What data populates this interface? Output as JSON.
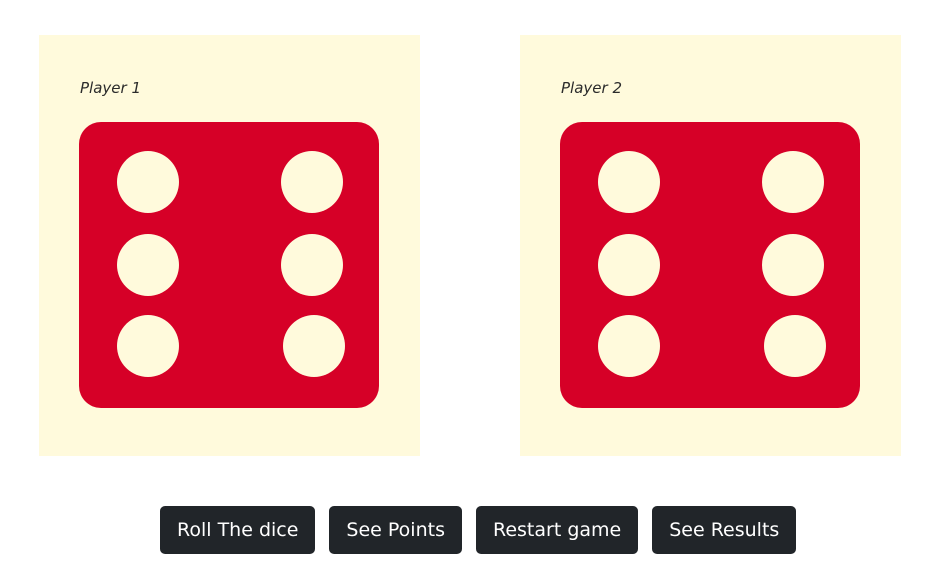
{
  "colors": {
    "panel_bg": "#fffadc",
    "die_red": "#d60027",
    "pip_cream": "#fffadc",
    "button_bg": "#212529",
    "button_text": "#ffffff"
  },
  "players": [
    {
      "label": "Player 1",
      "die_value": 6
    },
    {
      "label": "Player 2",
      "die_value": 6
    }
  ],
  "buttons": {
    "roll": "Roll The dice",
    "points": "See Points",
    "restart": "Restart game",
    "results": "See Results"
  }
}
